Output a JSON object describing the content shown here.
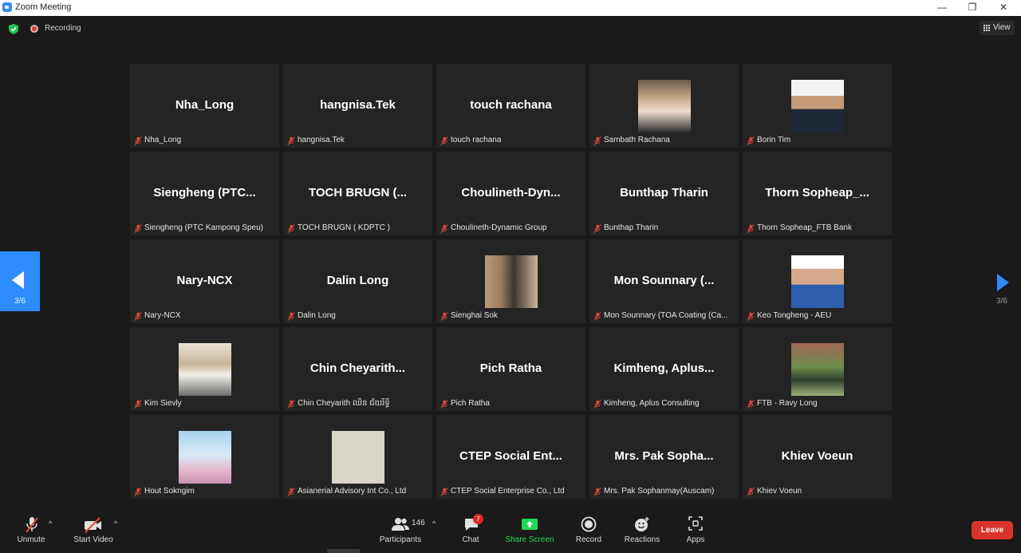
{
  "window": {
    "title": "Zoom Meeting",
    "controls": [
      "—",
      "❐",
      "✕"
    ]
  },
  "status": {
    "recording_label": "Recording"
  },
  "view_button": {
    "label": "View"
  },
  "pagination": {
    "left_page": "3/6",
    "right_page": "3/6"
  },
  "participants": [
    {
      "name": "Nha_Long",
      "label": "Nha_Long",
      "has_video": false
    },
    {
      "name": "hangnisa.Tek",
      "label": "hangnisa.Tek",
      "has_video": false
    },
    {
      "name": "touch rachana",
      "label": "touch rachana",
      "has_video": false
    },
    {
      "name": "Sambath Rachana",
      "label": "Sambath Rachana",
      "has_video": true
    },
    {
      "name": "Borin Tim",
      "label": "Borin Tim",
      "has_video": true
    },
    {
      "name": "Siengheng (PTC...",
      "label": "Siengheng (PTC Kampong Speu)",
      "has_video": false
    },
    {
      "name": "TOCH BRUGN (...",
      "label": "TOCH BRUGN ( KDPTC )",
      "has_video": false
    },
    {
      "name": "Choulineth-Dyn...",
      "label": "Choulineth-Dynamic Group",
      "has_video": false
    },
    {
      "name": "Bunthap Tharin",
      "label": "Bunthap Tharin",
      "has_video": false
    },
    {
      "name": "Thorn Sopheap_...",
      "label": "Thorn Sopheap_FTB Bank",
      "has_video": false
    },
    {
      "name": "Nary-NCX",
      "label": "Nary-NCX",
      "has_video": false
    },
    {
      "name": "Dalin Long",
      "label": "Dalin Long",
      "has_video": false
    },
    {
      "name": "Sienghai Sok",
      "label": "Sienghai Sok",
      "has_video": true
    },
    {
      "name": "Mon Sounnary (...",
      "label": "Mon Sounnary (TOA Coating (Ca...",
      "has_video": false
    },
    {
      "name": "Keo Tongheng - AEU",
      "label": "Keo Tongheng - AEU",
      "has_video": true
    },
    {
      "name": "Kim Sievly",
      "label": "Kim Sievly",
      "has_video": true
    },
    {
      "name": "Chin Cheyarith...",
      "label": "Chin Cheyarith ឈិន ជ័យរិទ្ធិ",
      "has_video": false
    },
    {
      "name": "Pich Ratha",
      "label": "Pich Ratha",
      "has_video": false
    },
    {
      "name": "Kimheng, Aplus...",
      "label": "Kimheng, Aplus Consulting",
      "has_video": false
    },
    {
      "name": "FTB - Ravy Long",
      "label": "FTB - Ravy Long",
      "has_video": true
    },
    {
      "name": "Hout Sokngim",
      "label": "Hout Sokngim",
      "has_video": true
    },
    {
      "name": "Asianerial Advisory Int Co., Ltd",
      "label": "Asianerial Advisory Int Co., Ltd",
      "has_video": true
    },
    {
      "name": "CTEP Social Ent...",
      "label": "CTEP Social Enterprise Co., Ltd",
      "has_video": false
    },
    {
      "name": "Mrs. Pak Sopha...",
      "label": "Mrs. Pak Sophanmay(Auscam)",
      "has_video": false
    },
    {
      "name": "Khiev Voeun",
      "label": "Khiev Voeun",
      "has_video": false
    }
  ],
  "toolbar": {
    "unmute": "Unmute",
    "start_video": "Start Video",
    "participants": "Participants",
    "participants_count": "146",
    "chat": "Chat",
    "chat_badge": "7",
    "share_screen": "Share Screen",
    "record": "Record",
    "reactions": "Reactions",
    "apps": "Apps",
    "leave": "Leave"
  },
  "colors": {
    "accent": "#2d8cff",
    "share_green": "#23d959",
    "leave_red": "#d9342b",
    "muted_red": "#e04a3a"
  }
}
